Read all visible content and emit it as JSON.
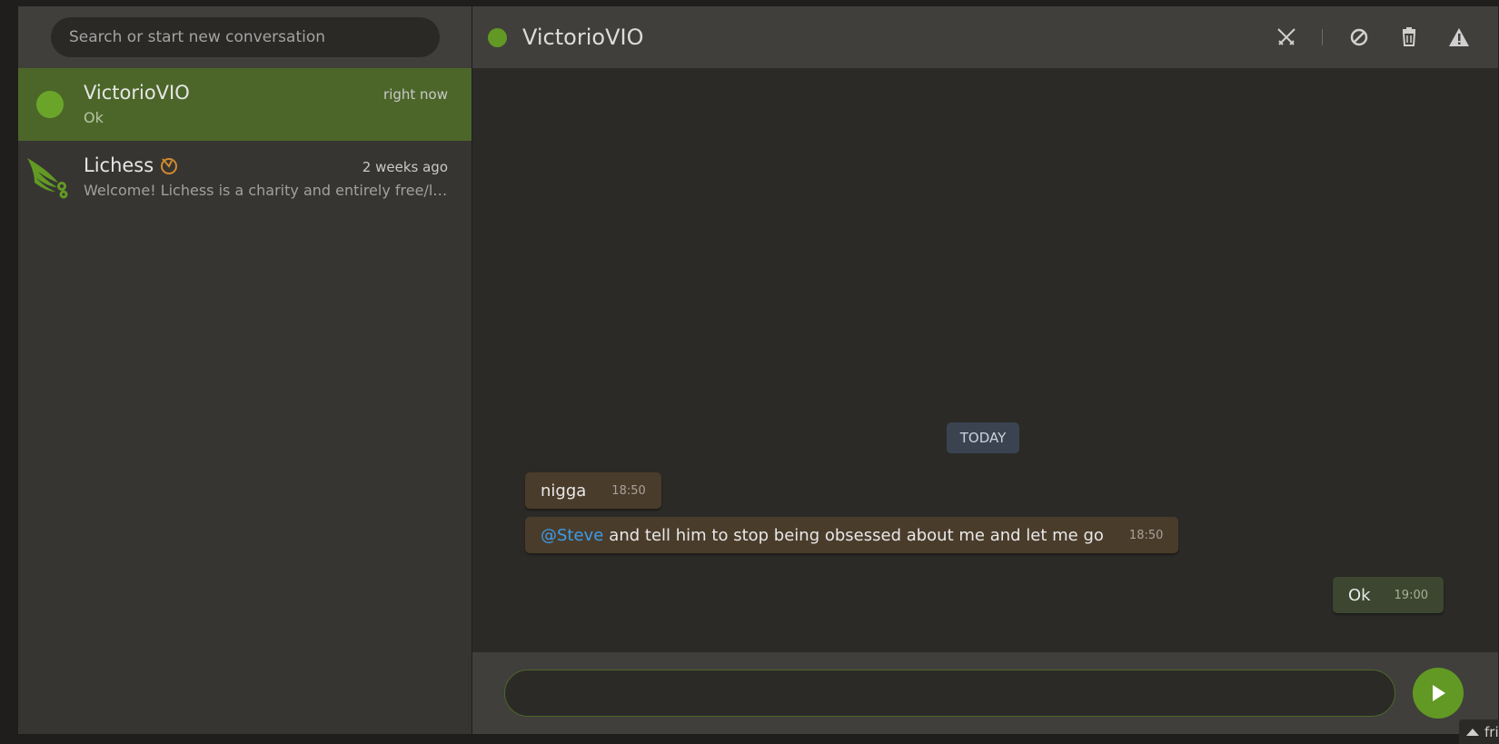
{
  "search": {
    "placeholder": "Search or start new conversation"
  },
  "contacts": [
    {
      "name": "VictorioVIO",
      "time": "right now",
      "preview": "Ok",
      "active": true,
      "online": true
    },
    {
      "name": "Lichess",
      "time": "2 weeks ago",
      "preview": "Welcome! Lichess is a charity and entirely free/libre open source software.",
      "active": false,
      "patron_icon": "patron-wings-icon"
    }
  ],
  "header": {
    "title": "VictorioVIO",
    "actions": [
      {
        "icon": "challenge-swords-icon"
      },
      {
        "icon": "block-icon"
      },
      {
        "icon": "trash-icon"
      },
      {
        "icon": "report-warning-icon"
      }
    ]
  },
  "conversation": {
    "day_label": "TODAY",
    "messages": [
      {
        "from": "them",
        "text": "nigga",
        "time": "18:50"
      },
      {
        "from": "them",
        "mention": "@Steve",
        "text": "and tell him to stop being obsessed about me and let me go",
        "time": "18:50"
      },
      {
        "from": "me",
        "text": "Ok",
        "time": "19:00"
      }
    ]
  },
  "composer": {
    "value": "",
    "send_icon": "send-play-icon"
  },
  "friends_tab": {
    "label": "friends"
  },
  "colors": {
    "accent_green": "#629924",
    "active_row": "#4c6629",
    "mention_blue": "#3d9be9",
    "their_bubble": "#4a3c2b",
    "my_bubble": "#3c4630"
  }
}
